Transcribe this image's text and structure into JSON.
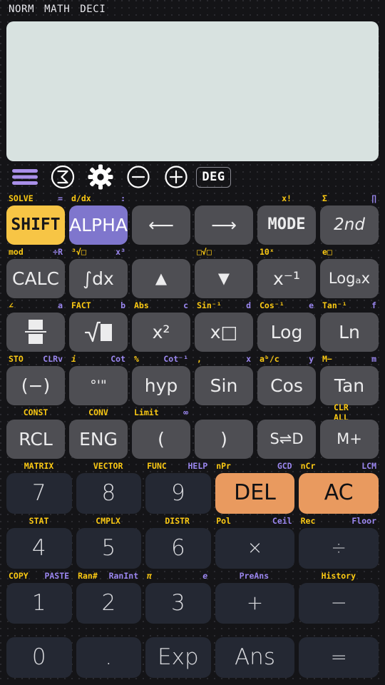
{
  "statusbar": {
    "mode1": "NORM",
    "mode2": "MATH",
    "mode3": "DECI"
  },
  "display": {
    "value": ""
  },
  "toolbar": {
    "menu": "menu-icon",
    "sigma": "sigma-icon",
    "settings": "gear-icon",
    "zoom_out": "minus-circle-icon",
    "zoom_in": "plus-circle-icon",
    "angle_unit": "DEG"
  },
  "colors": {
    "shift": "#f7c545",
    "alpha": "#7f76cd",
    "orange": "#e99a5f",
    "shift_label": "#fbc913",
    "alpha_label": "#9b87f0",
    "display_bg": "#d8e2e0",
    "key_bg": "#4e4e53",
    "num_key_bg": "#242833"
  },
  "keypad": {
    "row1": {
      "labels": [
        {
          "left": "SOLVE",
          "left_color": "yellow",
          "right": "=",
          "right_color": "purple"
        },
        {
          "left": "d/dx",
          "left_color": "yellow",
          "right": ":",
          "right_color": "purple"
        },
        {
          "left": "",
          "right": ""
        },
        {
          "left": "",
          "right": ""
        },
        {
          "center": "x!",
          "center_color": "yellow"
        },
        {
          "left": "Σ",
          "left_color": "yellow",
          "right": "∏",
          "right_color": "purple"
        }
      ],
      "keys": [
        "SHIFT",
        "ALPHA",
        "⟵",
        "⟶",
        "MODE",
        "2nd"
      ]
    },
    "row2": {
      "labels": [
        {
          "left": "mod",
          "left_color": "yellow",
          "right": "÷R",
          "right_color": "purple"
        },
        {
          "left": "³√□",
          "left_color": "yellow",
          "right": "x³",
          "right_color": "purple"
        },
        {
          "left": "",
          "right": ""
        },
        {
          "left": "□√□",
          "left_color": "yellow"
        },
        {
          "left": "10ˣ",
          "left_color": "yellow"
        },
        {
          "left": "e□",
          "left_color": "yellow"
        }
      ],
      "keys": [
        "CALC",
        "∫dx",
        "▲",
        "▼",
        "x⁻¹",
        "Logₐx"
      ]
    },
    "row3": {
      "labels": [
        {
          "left": "∠",
          "left_color": "yellow",
          "right": "a",
          "right_color": "purple"
        },
        {
          "left": "FACT",
          "left_color": "yellow",
          "right": "b",
          "right_color": "purple"
        },
        {
          "left": "Abs",
          "left_color": "yellow",
          "right": "c",
          "right_color": "purple"
        },
        {
          "left": "Sin⁻¹",
          "left_color": "yellow",
          "right": "d",
          "right_color": "purple"
        },
        {
          "left": "Cos⁻¹",
          "left_color": "yellow",
          "right": "e",
          "right_color": "purple"
        },
        {
          "left": "Tan⁻¹",
          "left_color": "yellow",
          "right": "f",
          "right_color": "purple"
        }
      ],
      "keys": [
        "fraction",
        "√",
        "x²",
        "x□",
        "Log",
        "Ln"
      ]
    },
    "row4": {
      "labels": [
        {
          "left": "STO",
          "left_color": "yellow",
          "right": "CLRv",
          "right_color": "purple"
        },
        {
          "left": "i",
          "left_color": "yellow",
          "right": "Cot",
          "right_color": "purple"
        },
        {
          "left": "%",
          "left_color": "yellow",
          "right": "Cot⁻¹",
          "right_color": "purple"
        },
        {
          "left": ",",
          "left_color": "yellow",
          "right": "x",
          "right_color": "purple"
        },
        {
          "left": "aᵇ/c",
          "left_color": "yellow",
          "right": "y",
          "right_color": "purple"
        },
        {
          "left": "M−",
          "left_color": "yellow",
          "right": "m",
          "right_color": "purple"
        }
      ],
      "keys": [
        "(−)",
        "°'\"",
        "hyp",
        "Sin",
        "Cos",
        "Tan"
      ]
    },
    "row5": {
      "labels": [
        {
          "center": "CONST",
          "center_color": "yellow"
        },
        {
          "center": "CONV",
          "center_color": "yellow"
        },
        {
          "left": "Limit",
          "left_color": "yellow",
          "right": "∞",
          "right_color": "purple"
        },
        {
          "left": "",
          "right": ""
        },
        {
          "left": "",
          "right": ""
        },
        {
          "center": "CLR ALL",
          "center_color": "yellow"
        }
      ],
      "keys": [
        "RCL",
        "ENG",
        "(",
        ")",
        "S⇌D",
        "M+"
      ]
    },
    "row6": {
      "labels": [
        {
          "center": "MATRIX",
          "center_color": "yellow"
        },
        {
          "center": "VECTOR",
          "center_color": "yellow"
        },
        {
          "left": "FUNC",
          "left_color": "yellow",
          "right": "HELP",
          "right_color": "purple"
        },
        {
          "left": "nPr",
          "left_color": "yellow",
          "right": "GCD",
          "right_color": "purple"
        },
        {
          "left": "nCr",
          "left_color": "yellow",
          "right": "LCM",
          "right_color": "purple"
        }
      ],
      "keys": [
        "7",
        "8",
        "9",
        "DEL",
        "AC"
      ]
    },
    "row7": {
      "labels": [
        {
          "center": "STAT",
          "center_color": "yellow"
        },
        {
          "center": "CMPLX",
          "center_color": "yellow"
        },
        {
          "center": "DISTR",
          "center_color": "yellow"
        },
        {
          "left": "Pol",
          "left_color": "yellow",
          "right": "Ceil",
          "right_color": "purple"
        },
        {
          "left": "Rec",
          "left_color": "yellow",
          "right": "Floor",
          "right_color": "purple"
        }
      ],
      "keys": [
        "4",
        "5",
        "6",
        "×",
        "÷"
      ]
    },
    "row8": {
      "labels": [
        {
          "left": "COPY",
          "left_color": "yellow",
          "right": "PASTE",
          "right_color": "purple"
        },
        {
          "left": "Ran#",
          "left_color": "yellow",
          "right": "RanInt",
          "right_color": "purple"
        },
        {
          "left": "π",
          "left_color": "yellow",
          "right": "e",
          "right_color": "purple"
        },
        {
          "center": "PreAns",
          "center_color": "purple"
        },
        {
          "center": "History",
          "center_color": "yellow"
        }
      ],
      "keys": [
        "1",
        "2",
        "3",
        "+",
        "−"
      ]
    },
    "row9": {
      "keys": [
        "0",
        ".",
        "Exp",
        "Ans",
        "="
      ]
    }
  }
}
